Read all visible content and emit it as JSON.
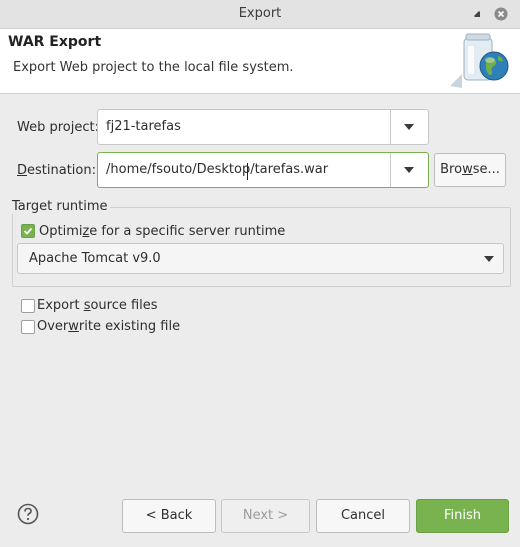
{
  "window": {
    "title": "Export"
  },
  "header": {
    "title": "WAR Export",
    "description": "Export Web project to the local file system."
  },
  "form": {
    "web_project_label": "Web project:",
    "web_project_value": "fj21-tarefas",
    "destination_label_pre": "",
    "destination_label_u": "D",
    "destination_label_post": "estination:",
    "destination_value": "/home/fsouto/Desktop/tarefas.war",
    "browse_pre": "Bro",
    "browse_u": "w",
    "browse_post": "se..."
  },
  "target_runtime": {
    "group_title": "Target runtime",
    "optimize_pre": "Optimi",
    "optimize_u": "z",
    "optimize_post": "e for a specific server runtime",
    "optimize_checked": true,
    "runtime_value": "Apache Tomcat v9.0"
  },
  "options": {
    "export_source_pre": "Export ",
    "export_source_u": "s",
    "export_source_post": "ource files",
    "export_source_checked": false,
    "overwrite_pre": "Over",
    "overwrite_u": "w",
    "overwrite_post": "rite existing file",
    "overwrite_checked": false
  },
  "buttons": {
    "back": "< Back",
    "next": "Next >",
    "cancel": "Cancel",
    "finish": "Finish"
  },
  "colors": {
    "accent": "#78b34f",
    "focus_border": "#7ab04e"
  }
}
